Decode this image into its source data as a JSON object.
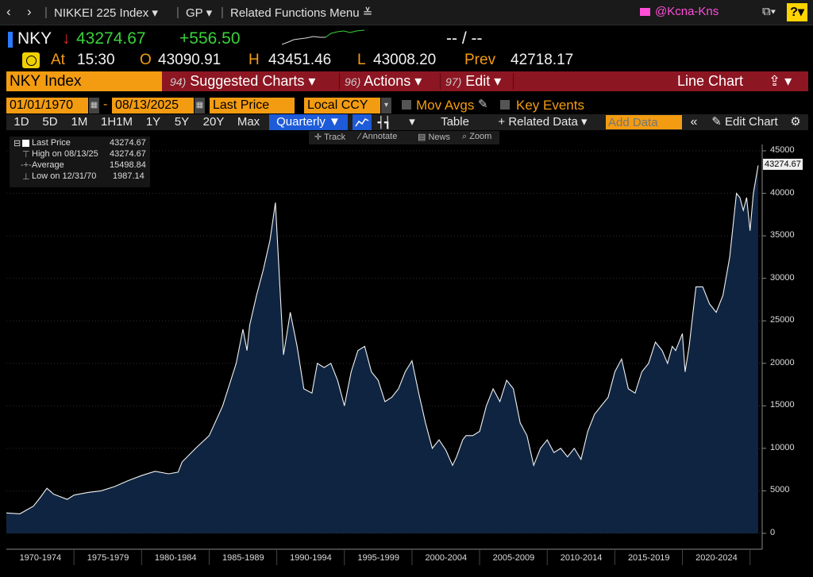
{
  "nav": {
    "security": "NIKKEI 225 Index",
    "function": "GP",
    "related": "Related Functions Menu",
    "user": "@Kcna-Kns",
    "help": "?"
  },
  "ticker": {
    "symbol": "NKY",
    "price": "43274.67",
    "change": "+556.50",
    "dashes": "-- / --",
    "at_label": "At",
    "time": "15:30",
    "o_label": "O",
    "open": "43090.91",
    "h_label": "H",
    "high": "43451.46",
    "l_label": "L",
    "low": "43008.20",
    "prev_label": "Prev",
    "prev": "42718.17"
  },
  "command_bar": {
    "security": "NKY Index",
    "suggested_num": "94)",
    "suggested": "Suggested Charts ▾",
    "actions_num": "96)",
    "actions": "Actions ▾",
    "edit_num": "97)",
    "edit": "Edit ▾",
    "chart_type": "Line Chart",
    "share": "⇪ ▾"
  },
  "params": {
    "start_date": "01/01/1970",
    "end_date": "08/13/2025",
    "field": "Last Price",
    "currency": "Local CCY",
    "mov_avgs": "Mov Avgs",
    "key_events": "Key Events"
  },
  "range_toolbar": {
    "ranges": [
      "1D",
      "5D",
      "1M",
      "1H1M",
      "1Y",
      "5Y",
      "20Y",
      "Max"
    ],
    "period": "Quarterly ▼",
    "table": "Table",
    "related_data": "+ Related Data ▾",
    "add_data_placeholder": "Add Data",
    "edit_chart": "Edit Chart"
  },
  "chart_tools": [
    "Track",
    "Annotate",
    "News",
    "Zoom"
  ],
  "legend": {
    "series": "Last Price",
    "series_value": "43274.67",
    "high_label": "High on 08/13/25",
    "high_value": "43274.67",
    "avg_label": "Average",
    "avg_value": "15498.84",
    "low_label": "Low on 12/31/70",
    "low_value": "1987.14"
  },
  "chart_data": {
    "type": "area",
    "title": "",
    "xlabel": "",
    "ylabel": "",
    "ylim": [
      0,
      45000
    ],
    "yticks": [
      0,
      5000,
      10000,
      15000,
      20000,
      25000,
      30000,
      35000,
      40000,
      45000
    ],
    "xtick_labels": [
      "1970-1974",
      "1975-1979",
      "1980-1984",
      "1985-1989",
      "1990-1994",
      "1995-1999",
      "2000-2004",
      "2005-2009",
      "2010-2014",
      "2015-2019",
      "2020-2024"
    ],
    "last_value_label": "43274.67",
    "series": [
      {
        "x": [
          1970.0,
          1971.0,
          1972.0,
          1972.5,
          1973.0,
          1973.5,
          1974.0,
          1974.5,
          1975.0,
          1976.0,
          1977.0,
          1978.0,
          1979.0,
          1980.0,
          1981.0,
          1982.0,
          1982.7,
          1983.0,
          1984.0,
          1985.0,
          1986.0,
          1987.0,
          1987.5,
          1987.8,
          1988.0,
          1988.5,
          1989.0,
          1989.5,
          1989.9,
          1990.5,
          1990.75,
          1991.0,
          1991.5,
          1992.0,
          1992.6,
          1993.0,
          1993.5,
          1994.0,
          1994.5,
          1995.0,
          1995.5,
          1996.0,
          1996.5,
          1997.0,
          1997.5,
          1998.0,
          1998.5,
          1999.0,
          1999.5,
          2000.0,
          2000.5,
          2001.0,
          2001.5,
          2002.0,
          2002.5,
          2003.0,
          2003.3,
          2003.75,
          2004.0,
          2004.5,
          2005.0,
          2005.5,
          2006.0,
          2006.5,
          2007.0,
          2007.5,
          2008.0,
          2008.5,
          2009.0,
          2009.5,
          2010.0,
          2010.5,
          2011.0,
          2011.5,
          2012.0,
          2012.5,
          2013.0,
          2013.5,
          2014.0,
          2014.5,
          2015.0,
          2015.5,
          2016.0,
          2016.5,
          2017.0,
          2017.5,
          2018.0,
          2018.5,
          2018.9,
          2019.25,
          2019.5,
          2020.0,
          2020.2,
          2020.5,
          2021.0,
          2021.5,
          2022.0,
          2022.5,
          2023.0,
          2023.5,
          2024.0,
          2024.25,
          2024.5,
          2024.75,
          2025.0,
          2025.25,
          2025.6
        ],
        "y": [
          2400,
          2300,
          3200,
          4200,
          5300,
          4600,
          4300,
          4000,
          4500,
          4800,
          5000,
          5500,
          6200,
          6800,
          7300,
          7000,
          7200,
          8400,
          10000,
          11500,
          15000,
          20000,
          24000,
          21500,
          24500,
          28000,
          31000,
          34500,
          38900,
          21000,
          23500,
          26000,
          22000,
          17000,
          16500,
          20000,
          19500,
          20000,
          18000,
          15000,
          19000,
          21500,
          22000,
          19000,
          18000,
          15500,
          16000,
          17000,
          19000,
          20300,
          16500,
          13000,
          10000,
          11000,
          9800,
          8000,
          9000,
          11000,
          11500,
          11500,
          12000,
          15000,
          17000,
          15500,
          18000,
          17000,
          13000,
          11500,
          8000,
          10000,
          11000,
          9500,
          10000,
          9000,
          10000,
          8700,
          12000,
          14000,
          15000,
          16000,
          19000,
          20500,
          17000,
          16500,
          19000,
          20000,
          22500,
          21500,
          20000,
          22000,
          21500,
          23500,
          19000,
          22000,
          29000,
          29000,
          27000,
          26000,
          28000,
          32500,
          40000,
          39500,
          38000,
          39500,
          35600,
          40000,
          43274.67
        ]
      }
    ]
  }
}
